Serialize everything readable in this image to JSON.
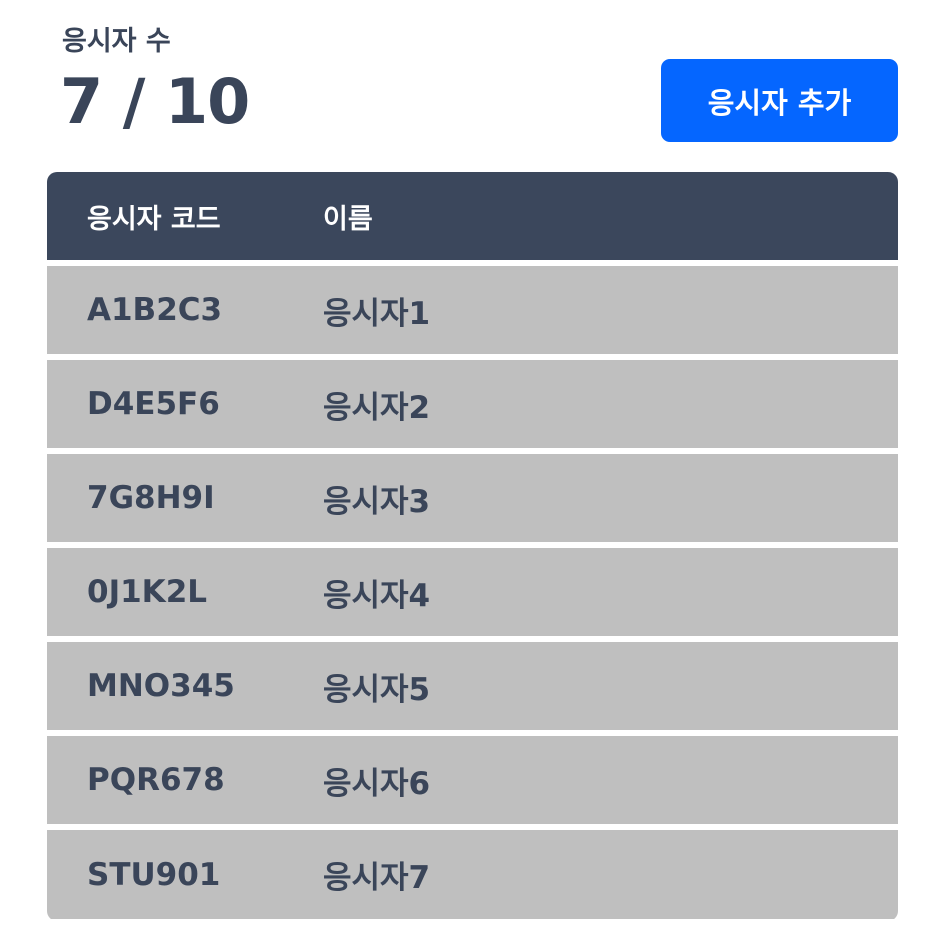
{
  "summary": {
    "label": "응시자 수",
    "count": "7 / 10"
  },
  "actions": {
    "add_label": "응시자 추가"
  },
  "table": {
    "headers": {
      "code": "응시자 코드",
      "name": "이름"
    },
    "rows": [
      {
        "code": "A1B2C3",
        "name": "응시자1"
      },
      {
        "code": "D4E5F6",
        "name": "응시자2"
      },
      {
        "code": "7G8H9I",
        "name": "응시자3"
      },
      {
        "code": "0J1K2L",
        "name": "응시자4"
      },
      {
        "code": "MNO345",
        "name": "응시자5"
      },
      {
        "code": "PQR678",
        "name": "응시자6"
      },
      {
        "code": "STU901",
        "name": "응시자7"
      }
    ]
  },
  "colors": {
    "accent": "#0566ff",
    "header_bg": "#3b475c",
    "row_bg": "#bfbfbf",
    "text": "#3a4559"
  }
}
